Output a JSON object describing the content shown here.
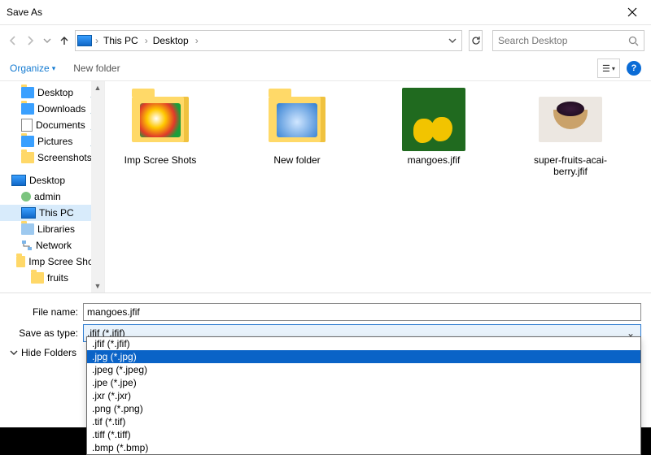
{
  "title": "Save As",
  "nav": {
    "crumb_root": "This PC",
    "crumb_loc": "Desktop",
    "refresh_tip": "Refresh"
  },
  "search": {
    "placeholder": "Search Desktop"
  },
  "toolbar": {
    "organize": "Organize",
    "newfolder": "New folder"
  },
  "tree": {
    "desktop": "Desktop",
    "downloads": "Downloads",
    "documents": "Documents",
    "pictures": "Pictures",
    "screenshots": "Screenshots",
    "desktop2": "Desktop",
    "admin": "admin",
    "thispc": "This PC",
    "libraries": "Libraries",
    "network": "Network",
    "impscree": "Imp Scree Shots",
    "fruits": "fruits"
  },
  "content": {
    "items": [
      {
        "label": "Imp Scree Shots"
      },
      {
        "label": "New folder"
      },
      {
        "label": "mangoes.jfif"
      },
      {
        "label": "super-fruits-acai-berry.jfif"
      }
    ]
  },
  "form": {
    "filename_label": "File name:",
    "filename_value": "mangoes.jfif",
    "type_label": "Save as type:",
    "type_value": ".jfif (*.jfif)",
    "options": [
      ".jfif (*.jfif)",
      ".jpg (*.jpg)",
      ".jpeg (*.jpeg)",
      ".jpe (*.jpe)",
      ".jxr (*.jxr)",
      ".png (*.png)",
      ".tif (*.tif)",
      ".tiff (*.tiff)",
      ".bmp (*.bmp)"
    ],
    "highlight_index": 1,
    "hide_folders": "Hide Folders"
  }
}
